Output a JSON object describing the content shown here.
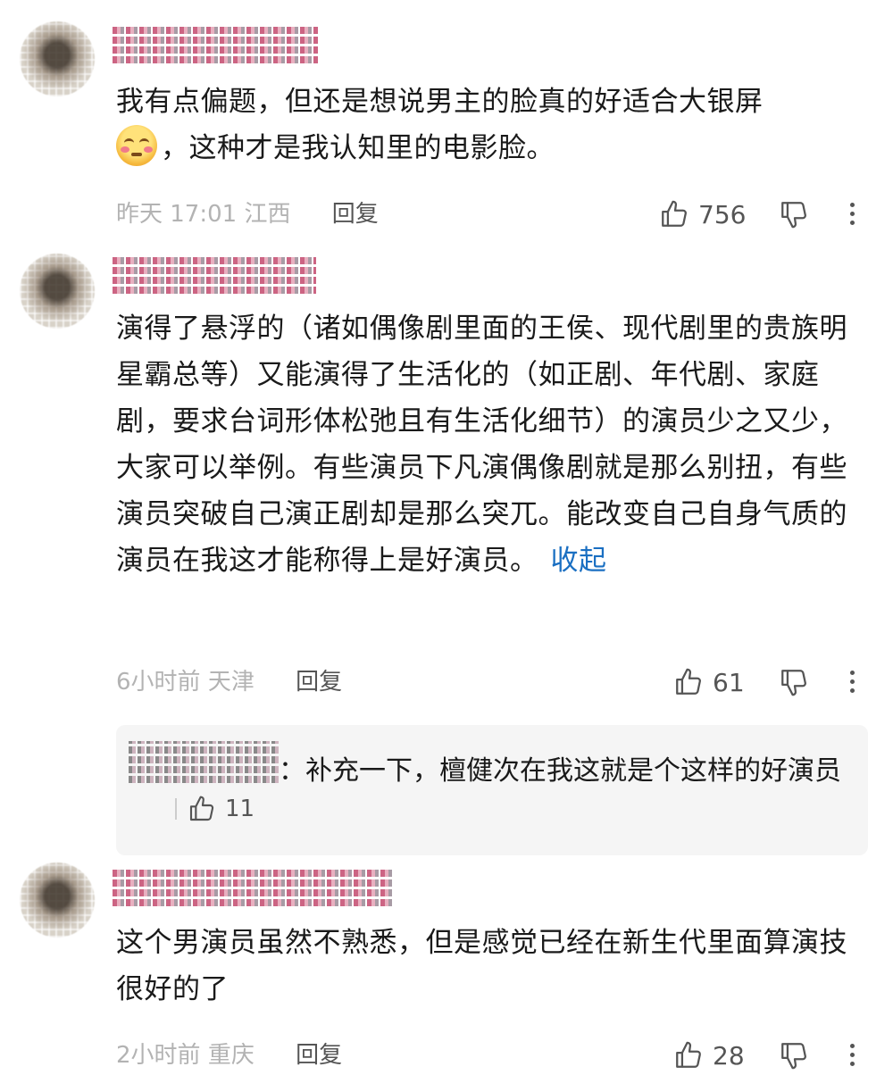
{
  "comments": [
    {
      "text_before_emoji": "我有点偏题，但还是想说男主的脸真的好适合大银屏",
      "text_after_emoji": "，这种才是我认知里的电影脸。",
      "emoji": "flushed-face-emoji",
      "time": "昨天 17:01",
      "location": "江西",
      "reply_label": "回复",
      "likes": "756"
    },
    {
      "text": "演得了悬浮的（诸如偶像剧里面的王侯、现代剧里的贵族明星霸总等）又能演得了生活化的（如正剧、年代剧、家庭剧，要求台词形体松弛且有生活化细节）的演员少之又少，大家可以举例。有些演员下凡演偶像剧就是那么别扭，有些演员突破自己演正剧却是那么突兀。能改变自己自身气质的演员在我这才能称得上是好演员。",
      "collapse_label": "收起",
      "time": "6小时前",
      "location": "天津",
      "reply_label": "回复",
      "likes": "61",
      "sub_reply": {
        "text": "：补充一下，檀健次在我这就是个这样的好演员",
        "likes": "11"
      }
    },
    {
      "text": "这个男演员虽然不熟悉，但是感觉已经在新生代里面算演技很好的了",
      "time": "2小时前",
      "location": "重庆",
      "reply_label": "回复",
      "likes": "28"
    }
  ],
  "icons": {
    "like": "thumbs-up-icon",
    "dislike": "thumbs-down-icon",
    "more": "more-vertical-icon"
  }
}
